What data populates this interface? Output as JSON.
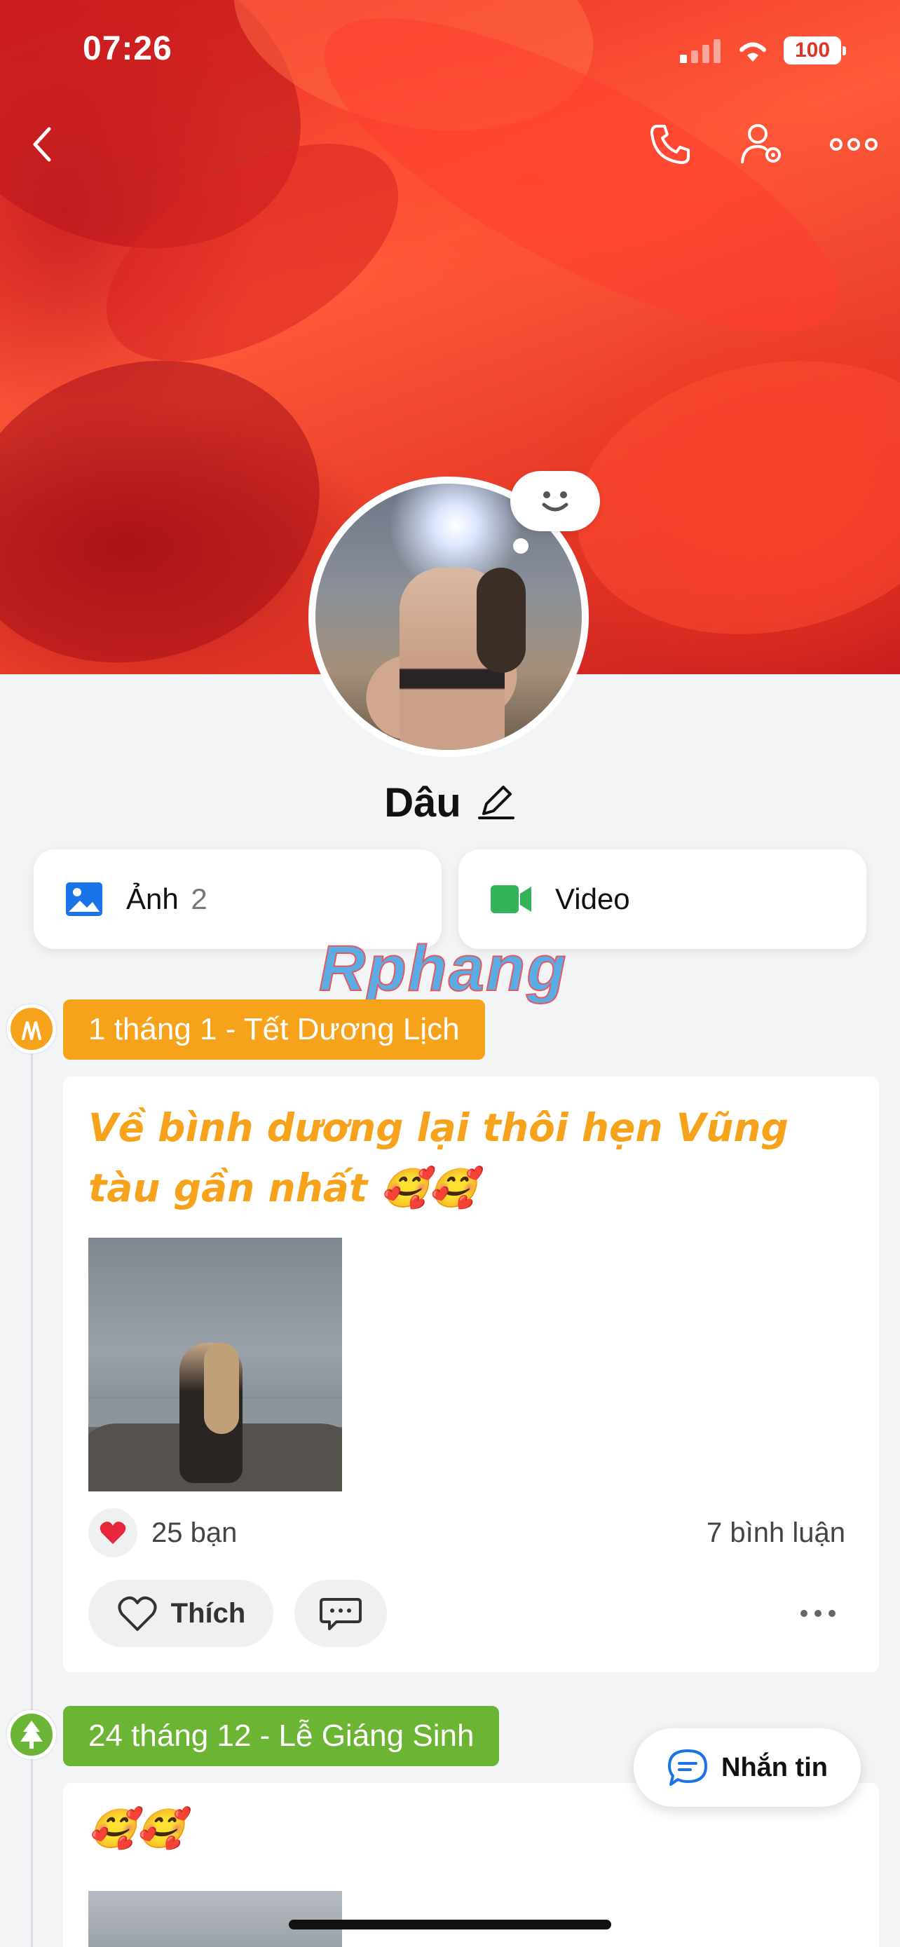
{
  "status_bar": {
    "time": "07:26",
    "battery": "100"
  },
  "header": {
    "back_icon": "chevron-left-icon",
    "call_icon": "phone-icon",
    "settings_icon": "user-settings-icon",
    "more_icon": "more-horizontal-icon"
  },
  "profile": {
    "name": "Dâu",
    "edit_icon": "pencil-icon",
    "mood_icon": "smiley-bubble-icon"
  },
  "media": {
    "photos_label": "Ảnh",
    "photos_count": "2",
    "video_label": "Video"
  },
  "watermark": "Rphang",
  "timeline": [
    {
      "event_label": "1 tháng 1 - Tết Dương Lịch",
      "event_color": "#f7a21b",
      "post_text": "Về bình dương lại thôi hẹn Vũng tàu gần nhất 🥰🥰",
      "reactions": "25 bạn",
      "comments": "7 bình luận",
      "like_label": "Thích"
    },
    {
      "event_label": "24 tháng 12 - Lễ Giáng Sinh",
      "event_color": "#6cb433",
      "post_text": "🥰🥰"
    }
  ],
  "message_button": {
    "label": "Nhắn tin"
  },
  "colors": {
    "accent": "#1a73e8",
    "video": "#34b35a"
  }
}
